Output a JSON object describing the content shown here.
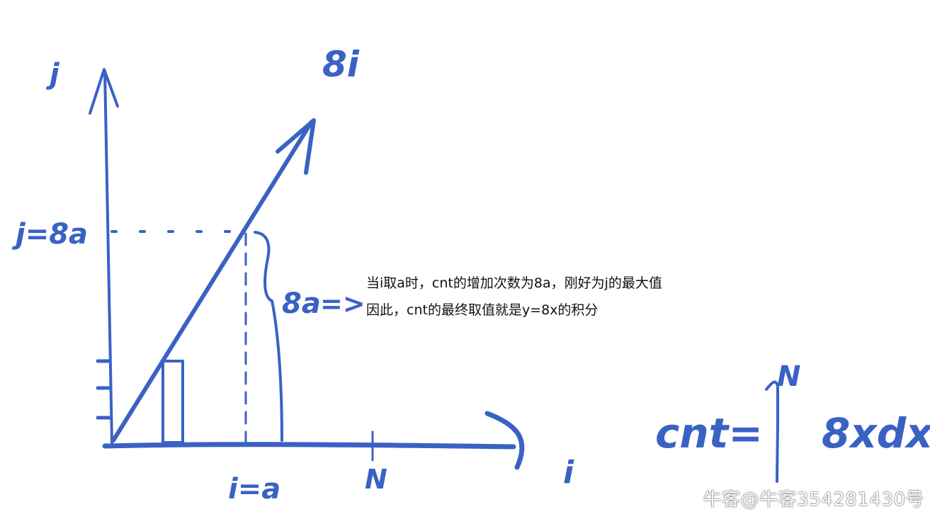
{
  "labels": {
    "j_axis": "j",
    "i_axis": "i",
    "line_label": "8i",
    "j_mark": "j=8a",
    "i_mark": "i=a",
    "n_mark": "N",
    "brace_label": "8a",
    "brace_arrow": "=>",
    "formula_lhs": "cnt=",
    "integral_upper": "N",
    "integrand": "8xdx"
  },
  "notes": {
    "line1": "当i取a时，cnt的增加次数为8a，刚好为j的最大值",
    "line2": "因此，cnt的最终取值就是y=8x的积分"
  },
  "watermark": "牛客@牛客354281430号",
  "colors": {
    "ink": "#3a62c4",
    "text": "#111111",
    "background": "#ffffff"
  }
}
